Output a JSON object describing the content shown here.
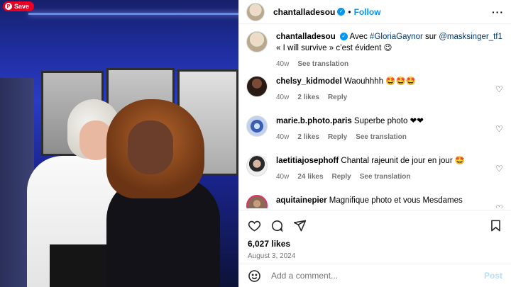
{
  "pin": {
    "save_label": "Save",
    "save_icon": "pinterest-icon"
  },
  "post": {
    "author": "chantalladesou",
    "follow_label": "Follow",
    "caption": {
      "text_before": "Avec ",
      "tag1": "#GloriaGaynor",
      "text_mid": " sur ",
      "tag2": "@masksinger_tf1",
      "line2": "« I will survive » c’est évident 😉",
      "time": "40w",
      "translate": "See translation"
    },
    "likes": "6,027 likes",
    "date": "August 3, 2024"
  },
  "comments": [
    {
      "user": "chelsy_kidmodel",
      "text": "Waouhhhh 🤩🤩🤩",
      "time": "40w",
      "likes": "2 likes",
      "reply": "Reply",
      "translate": ""
    },
    {
      "user": "marie.b.photo.paris",
      "text": "Superbe photo ❤❤",
      "time": "40w",
      "likes": "2 likes",
      "reply": "Reply",
      "translate": "See translation"
    },
    {
      "user": "laetitiajosephoff",
      "text": "Chantal rajeunit de jour en jour 🤩",
      "time": "40w",
      "likes": "24 likes",
      "reply": "Reply",
      "translate": "See translation"
    },
    {
      "user": "aquitainepier",
      "text": "Magnifique photo et vous Mesdames",
      "time": "",
      "likes": "",
      "reply": "",
      "translate": ""
    }
  ],
  "composer": {
    "placeholder": "Add a comment...",
    "post_label": "Post"
  },
  "colors": {
    "accent": "#0095f6",
    "pinterest": "#e60023",
    "muted": "#737373"
  }
}
